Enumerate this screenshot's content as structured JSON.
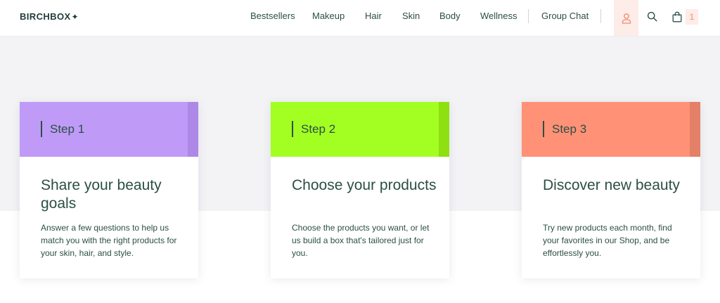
{
  "header": {
    "logo": "BIRCHBOX",
    "logo_mark": "✦",
    "nav": [
      "Bestsellers",
      "Makeup",
      "Hair",
      "Skin",
      "Body",
      "Wellness"
    ],
    "group_chat": "Group Chat",
    "icons": {
      "account": "user-icon",
      "search": "search-icon",
      "cart": "shopping-bag-icon"
    },
    "cart_count": "1"
  },
  "steps": [
    {
      "label": "Step 1",
      "title": "Share your beauty goals",
      "description": "Answer a few questions to help us match you with the right products for your skin, hair, and style.",
      "color": "#bf9bf7",
      "accent": "#ad88e6"
    },
    {
      "label": "Step 2",
      "title": "Choose your products",
      "description": "Choose the products you want, or let us build a box that's tailored just for you.",
      "color": "#a3ff22",
      "accent": "#8ee011"
    },
    {
      "label": "Step 3",
      "title": "Discover new beauty",
      "description": "Try new products each month, find your favorites in our Shop, and be effortlessly you.",
      "color": "#ff9177",
      "accent": "#e47f68"
    }
  ],
  "colors": {
    "brand_text": "#2b4f45",
    "band_bg": "#f3f3f6",
    "highlight_bg": "#fdece7",
    "highlight_fg": "#f08b6f"
  }
}
